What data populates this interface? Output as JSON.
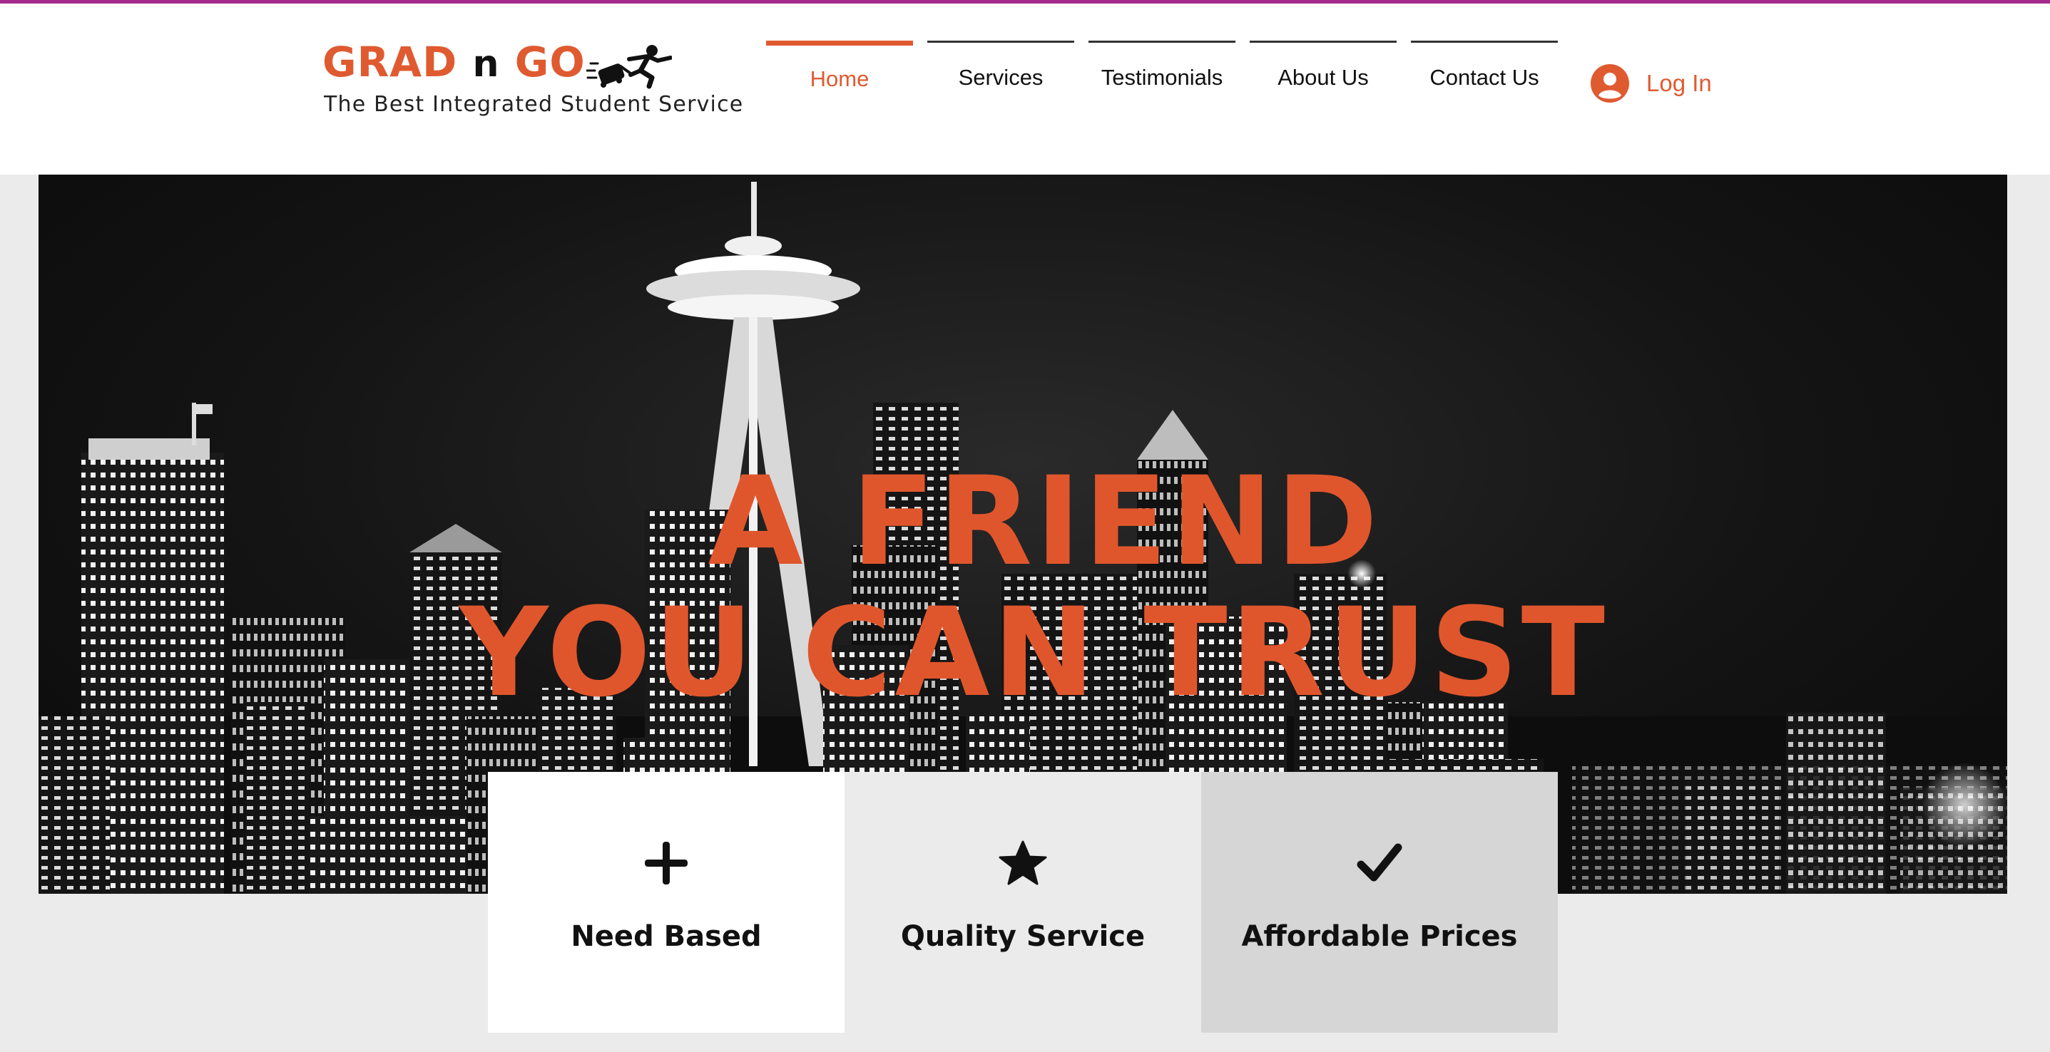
{
  "header": {
    "logo": {
      "brand_left": "GRAD",
      "brand_mid": "n",
      "brand_right": "GO",
      "tagline": "The Best Integrated Student Service",
      "icon": "running-traveler-icon"
    },
    "nav": [
      {
        "label": "Home",
        "active": true
      },
      {
        "label": "Services",
        "active": false
      },
      {
        "label": "Testimonials",
        "active": false
      },
      {
        "label": "About Us",
        "active": false
      },
      {
        "label": "Contact Us",
        "active": false
      }
    ],
    "login": {
      "label": "Log In",
      "icon": "user-avatar-icon"
    }
  },
  "hero": {
    "headline_line1": "A FRIEND",
    "headline_line2": "YOU CAN TRUST",
    "image": "black-and-white city skyline at night with tall observation tower"
  },
  "features": [
    {
      "label": "Need Based",
      "icon": "plus-icon"
    },
    {
      "label": "Quality Service",
      "icon": "star-icon"
    },
    {
      "label": "Affordable Prices",
      "icon": "checkmark-icon"
    }
  ],
  "colors": {
    "accent": "#e05a30",
    "top_strip": "#a52a8d",
    "page_background": "#ebebeb"
  }
}
